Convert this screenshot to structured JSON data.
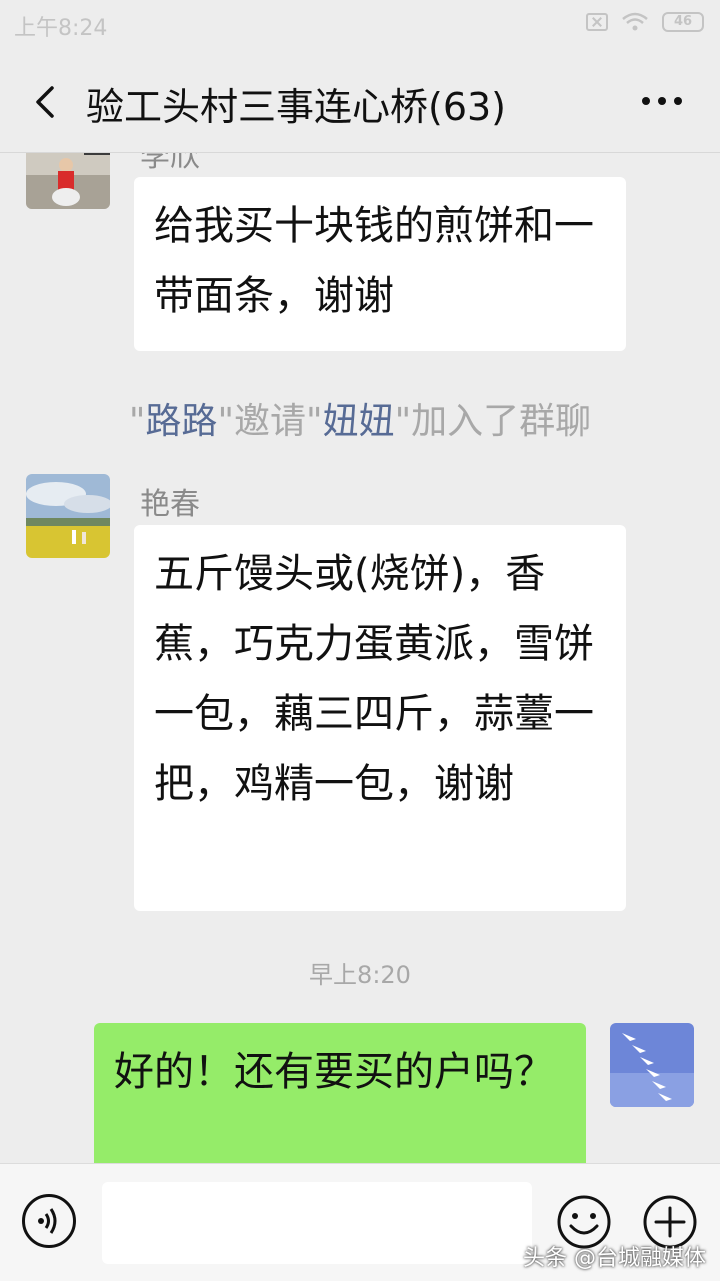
{
  "status_bar": {
    "time": "上午8:24",
    "battery": "46"
  },
  "nav": {
    "title": "验工头村三事连心桥(63)"
  },
  "messages": [
    {
      "sender": "李欣",
      "text": "给我买十块钱的煎饼和一带面条，谢谢"
    },
    {
      "sender": "艳春",
      "text": "五斤馒头或(烧饼)，香蕉，巧克力蛋黄派，雪饼一包，藕三四斤，蒜薹一把，鸡精一包，谢谢"
    },
    {
      "text": "好的！还有要买的户吗？"
    }
  ],
  "system_message": {
    "q1": "\"",
    "inviter": "路路",
    "mid": "\"邀请\"",
    "invitee": "妞妞",
    "tail": "\"加入了群聊"
  },
  "time_separator": "早上8:20",
  "input": {
    "placeholder": ""
  },
  "watermark": "头条 @台城融媒体"
}
